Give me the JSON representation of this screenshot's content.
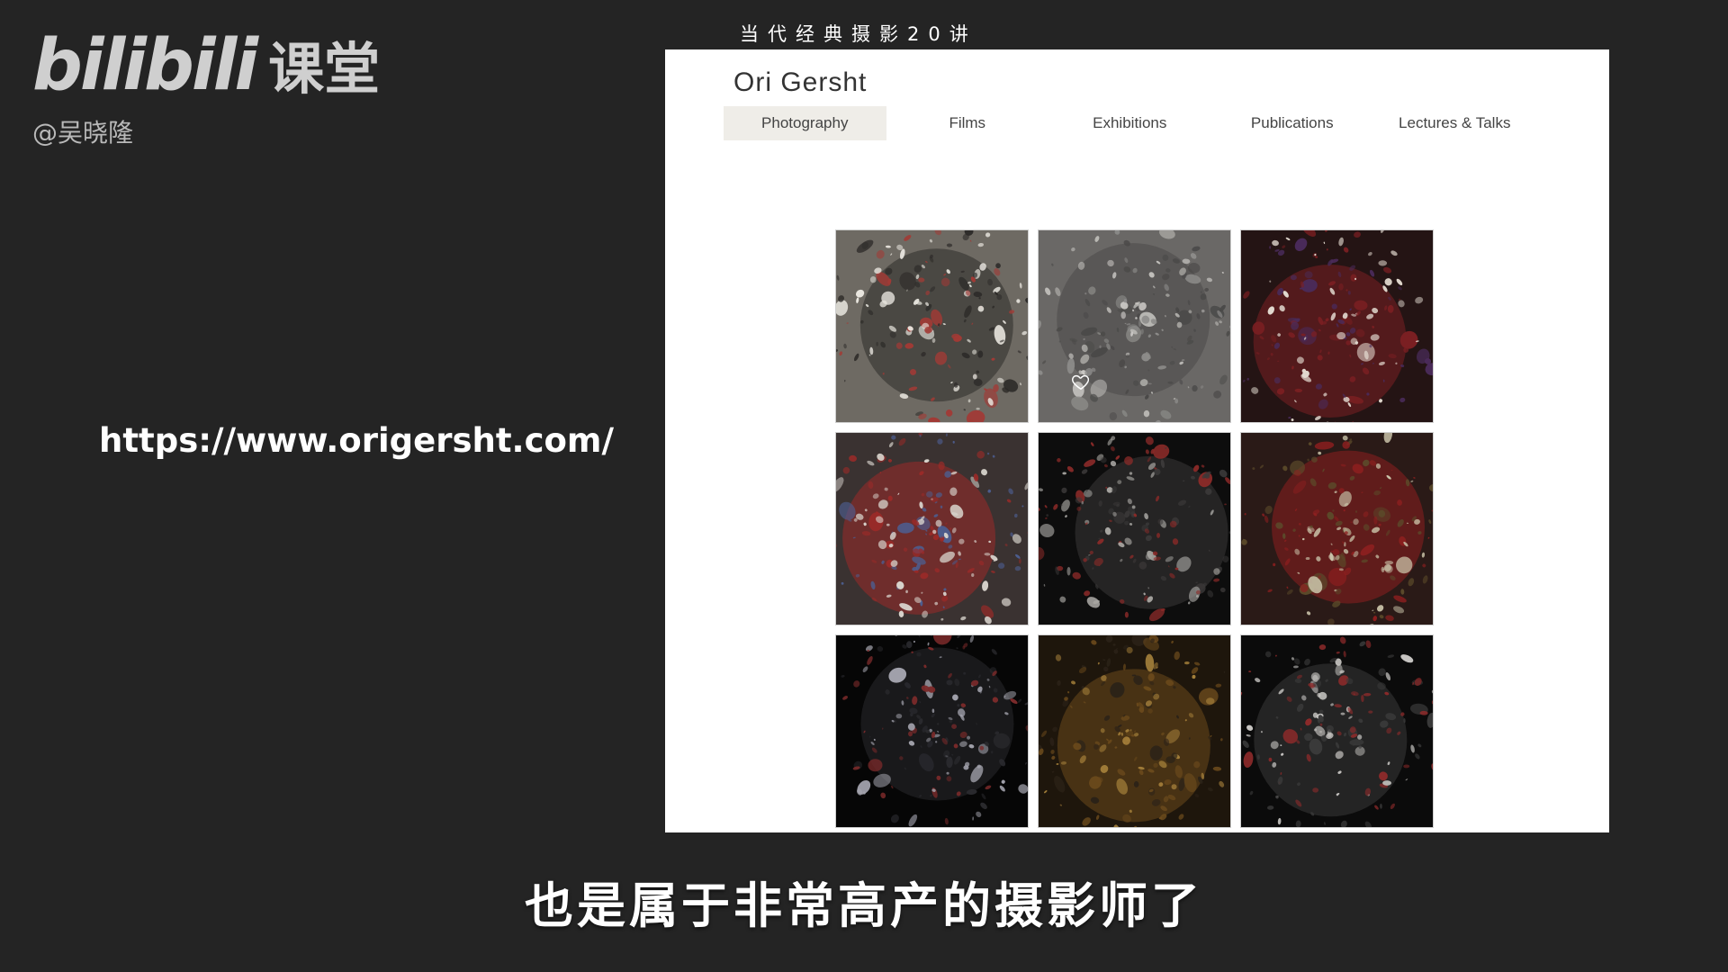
{
  "brand": {
    "logo_text": "bilibili",
    "logo_suffix": "课堂",
    "author": "@吴晓隆"
  },
  "course_title": "当代经典摄影20讲",
  "url_text": "https://www.origersht.com/",
  "subtitle": "也是属于非常高产的摄影师了",
  "site": {
    "title": "Ori Gersht",
    "nav": [
      {
        "label": "Photography",
        "active": true
      },
      {
        "label": "Films",
        "active": false
      },
      {
        "label": "Exhibitions",
        "active": false
      },
      {
        "label": "Publications",
        "active": false
      },
      {
        "label": "Lectures & Talks",
        "active": false
      }
    ],
    "gallery_tiles": [
      {
        "name": "flower-photo-1",
        "palette": [
          "#6e6a63",
          "#2d2b29",
          "#a23a35",
          "#e9e6df"
        ]
      },
      {
        "name": "flower-photo-2",
        "palette": [
          "#6a6866",
          "#4a4948",
          "#8d8c8a",
          "#c9c7c3"
        ]
      },
      {
        "name": "flower-photo-3",
        "palette": [
          "#241414",
          "#7a1f22",
          "#4a2b5a",
          "#e2d9cf"
        ]
      },
      {
        "name": "flower-photo-4",
        "palette": [
          "#3a3231",
          "#9b2a28",
          "#4d5d8e",
          "#d9d4cd"
        ]
      },
      {
        "name": "flower-photo-5",
        "palette": [
          "#0d0d0d",
          "#3b3939",
          "#a8a6a2",
          "#8a2a28"
        ]
      },
      {
        "name": "flower-photo-6",
        "palette": [
          "#2a1a17",
          "#8d1f1f",
          "#c9c2a8",
          "#5b4a2a"
        ]
      },
      {
        "name": "flower-photo-7",
        "palette": [
          "#060606",
          "#2a2a2e",
          "#a3a3ad",
          "#7a2a2a"
        ]
      },
      {
        "name": "flower-photo-8",
        "palette": [
          "#1e160c",
          "#6b4a1c",
          "#a47f3a",
          "#2b2218"
        ]
      },
      {
        "name": "flower-photo-9",
        "palette": [
          "#0b0b0b",
          "#3a3a3a",
          "#c7c5c2",
          "#8c2a2a"
        ]
      }
    ]
  }
}
